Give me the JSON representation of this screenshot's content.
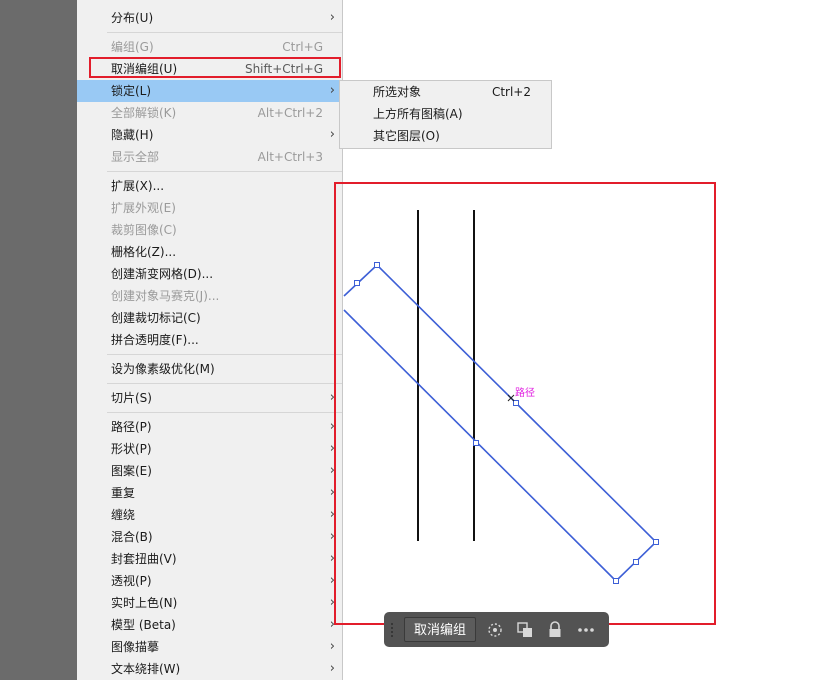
{
  "menu": {
    "items": [
      {
        "label": "分布(U)",
        "shortcut": "",
        "submenu": true,
        "disabled": false
      },
      {
        "label": "编组(G)",
        "shortcut": "Ctrl+G",
        "submenu": false,
        "disabled": true
      },
      {
        "label": "取消编组(U)",
        "shortcut": "Shift+Ctrl+G",
        "submenu": false,
        "disabled": false
      },
      {
        "label": "锁定(L)",
        "shortcut": "",
        "submenu": true,
        "disabled": false
      },
      {
        "label": "全部解锁(K)",
        "shortcut": "Alt+Ctrl+2",
        "submenu": false,
        "disabled": true
      },
      {
        "label": "隐藏(H)",
        "shortcut": "",
        "submenu": true,
        "disabled": false
      },
      {
        "label": "显示全部",
        "shortcut": "Alt+Ctrl+3",
        "submenu": false,
        "disabled": true
      },
      {
        "label": "扩展(X)...",
        "shortcut": "",
        "submenu": false,
        "disabled": false
      },
      {
        "label": "扩展外观(E)",
        "shortcut": "",
        "submenu": false,
        "disabled": true
      },
      {
        "label": "裁剪图像(C)",
        "shortcut": "",
        "submenu": false,
        "disabled": true
      },
      {
        "label": "栅格化(Z)...",
        "shortcut": "",
        "submenu": false,
        "disabled": false
      },
      {
        "label": "创建渐变网格(D)...",
        "shortcut": "",
        "submenu": false,
        "disabled": false
      },
      {
        "label": "创建对象马赛克(J)...",
        "shortcut": "",
        "submenu": false,
        "disabled": true
      },
      {
        "label": "创建裁切标记(C)",
        "shortcut": "",
        "submenu": false,
        "disabled": false
      },
      {
        "label": "拼合透明度(F)...",
        "shortcut": "",
        "submenu": false,
        "disabled": false
      },
      {
        "label": "设为像素级优化(M)",
        "shortcut": "",
        "submenu": false,
        "disabled": false
      },
      {
        "label": "切片(S)",
        "shortcut": "",
        "submenu": true,
        "disabled": false
      },
      {
        "label": "路径(P)",
        "shortcut": "",
        "submenu": true,
        "disabled": false
      },
      {
        "label": "形状(P)",
        "shortcut": "",
        "submenu": true,
        "disabled": false
      },
      {
        "label": "图案(E)",
        "shortcut": "",
        "submenu": true,
        "disabled": false
      },
      {
        "label": "重复",
        "shortcut": "",
        "submenu": true,
        "disabled": false
      },
      {
        "label": "缠绕",
        "shortcut": "",
        "submenu": true,
        "disabled": false
      },
      {
        "label": "混合(B)",
        "shortcut": "",
        "submenu": true,
        "disabled": false
      },
      {
        "label": "封套扭曲(V)",
        "shortcut": "",
        "submenu": true,
        "disabled": false
      },
      {
        "label": "透视(P)",
        "shortcut": "",
        "submenu": true,
        "disabled": false
      },
      {
        "label": "实时上色(N)",
        "shortcut": "",
        "submenu": true,
        "disabled": false
      },
      {
        "label": "模型 (Beta)",
        "shortcut": "",
        "submenu": true,
        "disabled": false
      },
      {
        "label": "图像描摹",
        "shortcut": "",
        "submenu": true,
        "disabled": false
      },
      {
        "label": "文本绕排(W)",
        "shortcut": "",
        "submenu": true,
        "disabled": false
      }
    ],
    "highlighted_index": 3
  },
  "submenu": {
    "items": [
      {
        "label": "所选对象",
        "shortcut": "Ctrl+2"
      },
      {
        "label": "上方所有图稿(A)",
        "shortcut": ""
      },
      {
        "label": "其它图层(O)",
        "shortcut": ""
      }
    ]
  },
  "canvas": {
    "path_label": "路径"
  },
  "toolbar": {
    "ungroup_label": "取消编组",
    "icons": [
      "recolor-icon",
      "duplicate-icon",
      "lock-icon",
      "more-icon"
    ]
  },
  "colors": {
    "highlight": "#99c9f4",
    "annotation_red": "#e21d2b",
    "path_blue": "#3d5fd6",
    "path_label_magenta": "#e01ee0"
  }
}
